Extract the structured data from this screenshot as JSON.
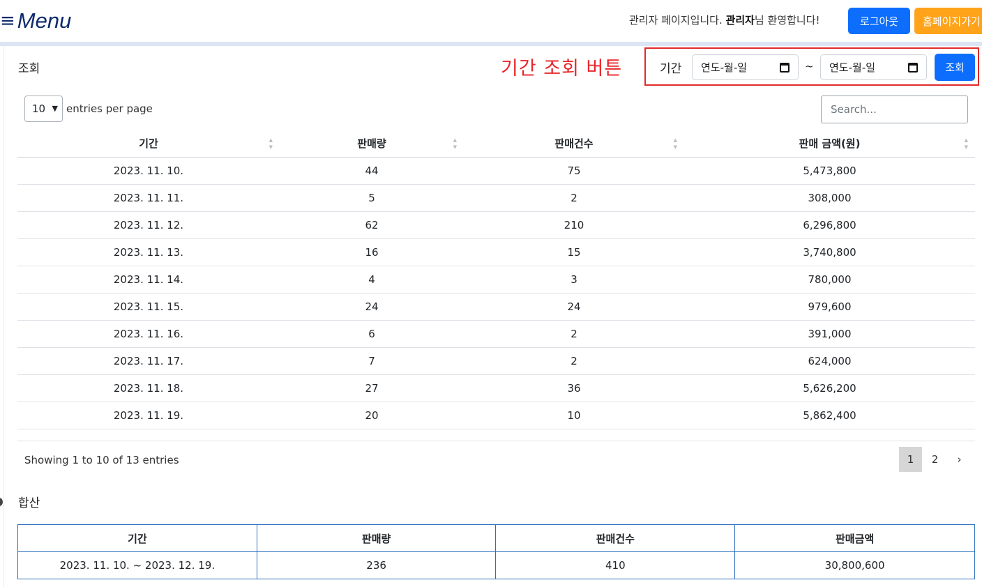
{
  "header": {
    "menu_icon": "≡",
    "menu_label": "Menu",
    "welcome_prefix": "관리자 페이지입니다. ",
    "welcome_user": "관리자",
    "welcome_suffix": "님 환영합니다!",
    "logout_label": "로그아웃",
    "home_label": "홈페이지가기"
  },
  "query": {
    "title": "조회",
    "annotation": "기간 조회 버튼",
    "period_label": "기간",
    "start_placeholder": "연도-월-일",
    "end_placeholder": "연도-월-일",
    "separator": "~",
    "submit_label": "조회"
  },
  "table_controls": {
    "per_page_value": "10",
    "per_page_label": "entries per page",
    "search_placeholder": "Search..."
  },
  "main_table": {
    "columns": [
      "기간",
      "판매량",
      "판매건수",
      "판매 금액(원)"
    ],
    "rows": [
      [
        "2023. 11. 10.",
        "44",
        "75",
        "5,473,800"
      ],
      [
        "2023. 11. 11.",
        "5",
        "2",
        "308,000"
      ],
      [
        "2023. 11. 12.",
        "62",
        "210",
        "6,296,800"
      ],
      [
        "2023. 11. 13.",
        "16",
        "15",
        "3,740,800"
      ],
      [
        "2023. 11. 14.",
        "4",
        "3",
        "780,000"
      ],
      [
        "2023. 11. 15.",
        "24",
        "24",
        "979,600"
      ],
      [
        "2023. 11. 16.",
        "6",
        "2",
        "391,000"
      ],
      [
        "2023. 11. 17.",
        "7",
        "2",
        "624,000"
      ],
      [
        "2023. 11. 18.",
        "27",
        "36",
        "5,626,200"
      ],
      [
        "2023. 11. 19.",
        "20",
        "10",
        "5,862,400"
      ]
    ]
  },
  "pagination": {
    "summary": "Showing 1 to 10 of 13 entries",
    "pages": [
      "1",
      "2"
    ],
    "next": "›",
    "current": "1"
  },
  "summary": {
    "title": "합산",
    "columns": [
      "기간",
      "판매량",
      "판매건수",
      "판매금액"
    ],
    "row": [
      "2023. 11. 10. ~ 2023. 12. 19.",
      "236",
      "410",
      "30,800,600"
    ]
  },
  "colors": {
    "primary": "#0d6efd",
    "home_button": "#ffa31a",
    "annotation": "#e8262a",
    "menu_text": "#0d2a6b",
    "summary_border": "#2b6fbf"
  }
}
